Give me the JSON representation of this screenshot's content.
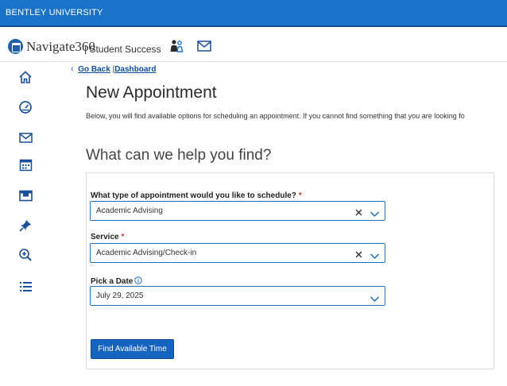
{
  "topbar": {
    "institution": "BENTLEY UNIVERSITY"
  },
  "header": {
    "brand": "Navigate360",
    "brand_separator": "|",
    "product": "Student Success",
    "icons": [
      "people-icon",
      "mail-icon"
    ]
  },
  "sidebar": {
    "items": [
      "home-icon",
      "dashboard-gauge-icon",
      "mail-icon",
      "calendar-icon",
      "card-icon",
      "pin-icon",
      "zoom-in-icon",
      "list-icon"
    ]
  },
  "breadcrumb": {
    "back": "Go Back",
    "separator": "|",
    "dashboard": "Dashboard"
  },
  "page": {
    "title": "New Appointment",
    "intro": "Below, you will find available options for scheduling an appointment. If you cannot find something that you are looking fo",
    "subtitle": "What can we help you find?"
  },
  "form": {
    "type_label": "What type of appointment would you like to schedule?",
    "type_value": "Academic Advising",
    "service_label": "Service",
    "service_value": "Academic Advising/Check-in",
    "date_label": "Pick a Date",
    "date_value": "July 29, 2025",
    "required_marker": "*",
    "submit": "Find Available Time"
  },
  "colors": {
    "topbar": "#1a73c8",
    "primary_button": "#1565c0",
    "link": "#0b4f9c",
    "required": "#d13438",
    "field_border": "#1f6fbf"
  }
}
